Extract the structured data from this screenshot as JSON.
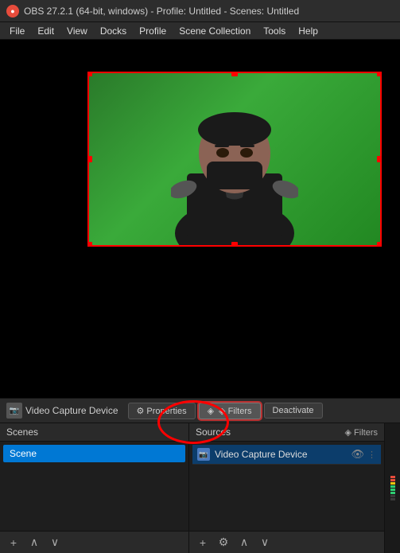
{
  "titleBar": {
    "icon": "●",
    "text": "OBS 27.2.1 (64-bit, windows) - Profile: Untitled - Scenes: Untitled"
  },
  "menuBar": {
    "items": [
      "File",
      "Edit",
      "View",
      "Docks",
      "Profile",
      "Scene Collection",
      "Tools",
      "Help"
    ]
  },
  "sourceToolbar": {
    "sourceIcon": "📷",
    "sourceLabel": "Video Capture Device",
    "propertiesBtn": "⚙ Properties",
    "filtersBtn": "◈ Filters",
    "deactivateBtn": "Deactivate"
  },
  "scenesPanel": {
    "header": "Scenes",
    "scenes": [
      {
        "name": "Scene",
        "selected": true
      }
    ],
    "addBtn": "+",
    "upBtn": "∧",
    "downBtn": "∨"
  },
  "sourcesPanel": {
    "header": "Sources",
    "filterHeader": "◈ Filters",
    "sources": [
      {
        "name": "Video Capture Device",
        "type": "cam",
        "visible": true,
        "selected": true
      }
    ],
    "addBtn": "+",
    "settingsBtn": "⚙",
    "upBtn": "∧",
    "downBtn": "∨"
  },
  "preview": {
    "label": "Preview Canvas"
  },
  "volumePanel": {
    "label": "Volume Meter"
  }
}
